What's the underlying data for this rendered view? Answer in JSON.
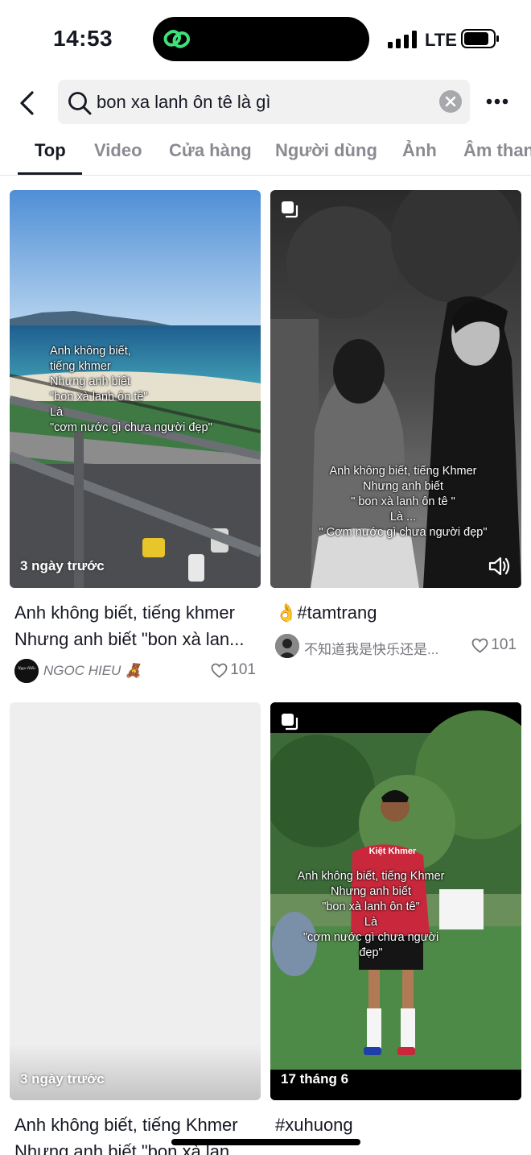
{
  "status_bar": {
    "time": "14:53",
    "network": "LTE",
    "icons": [
      "link-icon",
      "signal-icon",
      "battery-icon"
    ]
  },
  "search": {
    "query": "bon xa lanh ôn tê là gì",
    "icons": [
      "back-icon",
      "search-icon",
      "clear-icon",
      "more-icon"
    ]
  },
  "tabs": [
    "Top",
    "Video",
    "Cửa hàng",
    "Người dùng",
    "Ảnh",
    "Âm thanh"
  ],
  "active_tab": "Top",
  "results": [
    {
      "overlay": "Anh không biết,\ntiếng khmer\nNhưng anh biết\n\"bon xà lanh ôn tê\"\nLà\n\"cơm nước gì chưa người đẹp\"",
      "date": "3 ngày trước",
      "caption_line1": "Anh không biết, tiếng khmer",
      "caption_line2": "Nhưng anh biết \"bon xà lan...",
      "author": "NGOC HIEU 🧸",
      "avatar_text": "Ngọc Hiếu",
      "likes": "101"
    },
    {
      "overlay": "Anh không biết, tiếng Khmer\nNhưng anh biết\n\" bon xà lanh ôn tê \"\nLà ...\n\" Cơm nước gì chưa người đẹp\"",
      "caption_line1": "👌#tamtrang",
      "author": "不知道我是快乐还是...",
      "likes": "101"
    },
    {
      "date": "3 ngày trước",
      "caption_line1": "Anh không biết, tiếng Khmer",
      "caption_line2": "Nhưng anh biết \"bon xà lan"
    },
    {
      "overlay": "Anh không biết, tiếng Khmer\nNhưng anh biết\n\"bon xà lanh ôn tê\"\nLà\n\"cơm nước gì chưa người\nđẹp\"",
      "jersey_text": "Kiệt Khmer",
      "date": "17 tháng 6",
      "caption_line1": "#xuhuong"
    }
  ]
}
